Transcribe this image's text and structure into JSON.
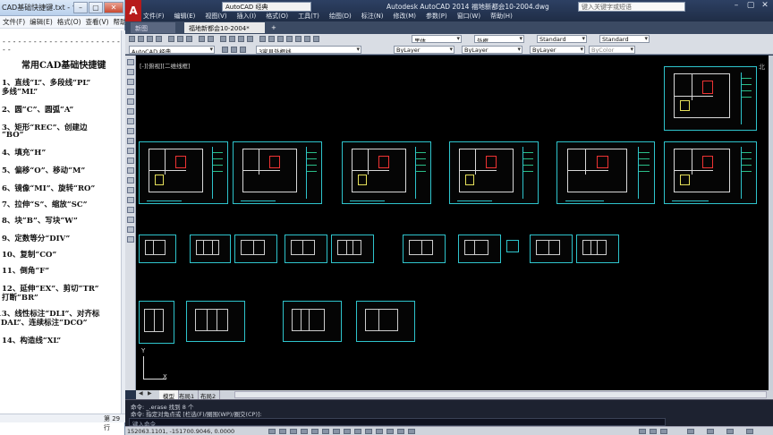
{
  "notepad": {
    "title": "CAD基础快捷键.txt - 记事本",
    "min_icon": "minimize-icon",
    "max_icon": "maximize-icon",
    "close_icon": "close-icon",
    "menu": [
      "文件(F)",
      "编辑(E)",
      "格式(O)",
      "查看(V)",
      "帮助(H)"
    ],
    "dashes": "-------------------------",
    "heading": "常用CAD基础快捷键",
    "lines": [
      "1、直线“L”、多段线“PL”",
      "多线“ML”",
      "2、圆“C”、圆弧“A”",
      "3、矩形“REC”、创建边",
      "“BO”",
      "4、填充“H”",
      "5、偏移“O”、移动“M”",
      "6、镜像“MI”、旋转“RO”",
      "7、拉伸“S”、缩放“SC”",
      "8、块“B”、写块“W”",
      "9、定数等分“DIV”",
      "10、复制“CO”",
      "11、倒角“F”",
      "12、延伸“EX”、剪切“TR”",
      "打断“BR”",
      "13、线性标注“DLI”、对齐标",
      "“DAL”、连续标注“DCO”",
      "14、构造线“XL”"
    ],
    "status": "第 29 行"
  },
  "acad": {
    "logo": "A",
    "workspace": "AutoCAD 经典",
    "title": "Autodesk AutoCAD 2014    福地新都会10-2004.dwg",
    "search_placeholder": "键入关键字或短语",
    "menu": [
      "文件(F)",
      "编辑(E)",
      "视图(V)",
      "插入(I)",
      "格式(O)",
      "工具(T)",
      "绘图(D)",
      "标注(N)",
      "修改(M)",
      "参数(P)",
      "窗口(W)",
      "帮助(H)"
    ],
    "tabs": {
      "start": "新图",
      "doc": "福地新都会10-2004*",
      "plus": "+"
    },
    "toolbar": {
      "text_style": "黑体",
      "dim_style": "外框",
      "table_style": "Standard",
      "mleader_style": "Standard",
      "workspace2": "AutoCAD 经典",
      "layer": "3家具外框线",
      "color": "ByLayer",
      "linetype": "ByLayer",
      "lineweight": "ByLayer",
      "plotstyle": "ByColor"
    },
    "viewport_label": "[-][俯视][二维线框]",
    "compass": "北",
    "ucs": {
      "x": "X",
      "y": "Y"
    },
    "layout_tabs": [
      "模型",
      "布局1",
      "布局2"
    ],
    "command_history": [
      "命令: _.erase 找到 8 个",
      "命令: 指定对角点或 [栏选(F)/圈围(WP)/圈交(CP)]:"
    ],
    "command_placeholder": "键入命令",
    "coords": "152063.1101, -151700.9046, 0.0000"
  }
}
